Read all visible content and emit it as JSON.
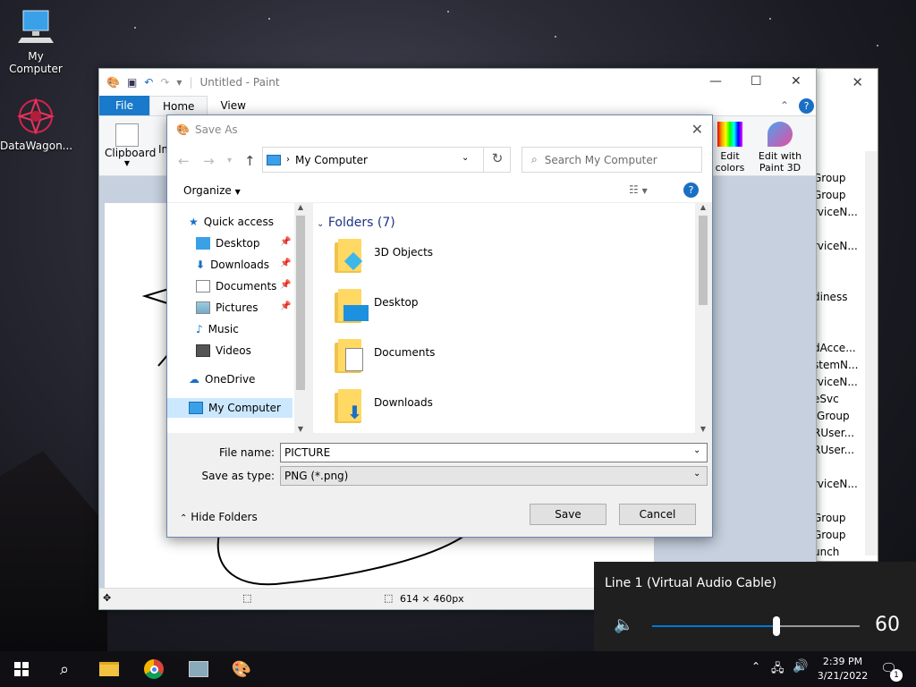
{
  "desktop": {
    "icons": [
      {
        "label": "My Computer"
      },
      {
        "label": "DataWagon..."
      }
    ]
  },
  "background_window": {
    "rows": [
      "Group",
      "Group",
      "rviceN...",
      "rviceN...",
      "diness",
      "dAcce...",
      "stemN...",
      "rviceN...",
      "eSvc",
      "/Group",
      "RUser...",
      "RUser...",
      "rviceN...",
      "Group",
      "Group",
      "unch"
    ]
  },
  "paint": {
    "title": "Untitled - Paint",
    "tabs": {
      "file": "File",
      "home": "Home",
      "view": "View"
    },
    "ribbon": {
      "clipboard": "Clipboard",
      "image_partial": "Im",
      "edit_colors": "Edit colors",
      "edit_paint3d_line1": "Edit with",
      "edit_paint3d_line2": "Paint 3D"
    },
    "status": {
      "size": "614 × 460px"
    }
  },
  "dialog": {
    "title": "Save As",
    "address": "My Computer",
    "search_placeholder": "Search My Computer",
    "organize": "Organize",
    "nav": {
      "quick_access": "Quick access",
      "items": [
        "Desktop",
        "Downloads",
        "Documents",
        "Pictures",
        "Music",
        "Videos"
      ],
      "onedrive": "OneDrive",
      "my_computer": "My Computer"
    },
    "folders_header": "Folders (7)",
    "folders": [
      "3D Objects",
      "Desktop",
      "Documents",
      "Downloads"
    ],
    "file_name_label": "File name:",
    "file_name_value": "PICTURE",
    "save_type_label": "Save as type:",
    "save_type_value": "PNG (*.png)",
    "hide_folders": "Hide Folders",
    "save": "Save",
    "cancel": "Cancel"
  },
  "volume": {
    "device": "Line 1 (Virtual Audio Cable)",
    "level": "60",
    "level_fraction": 0.6
  },
  "taskbar": {
    "time": "2:39 PM",
    "date": "3/21/2022",
    "notification_count": "1"
  },
  "colors": {
    "accent": "#0078d7",
    "file_tab": "#1979ca",
    "taskbar": "#101014"
  }
}
